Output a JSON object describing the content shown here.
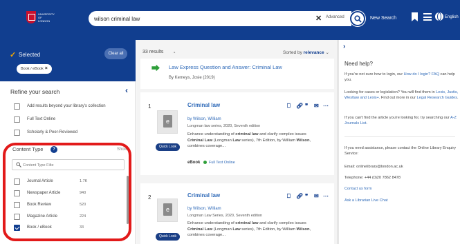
{
  "header": {
    "logo_text": "UNIVERSITY OF LONDON",
    "search_value": "wilson criminal law",
    "advanced_label": "Advanced",
    "new_search_label": "New Search",
    "language_label": "English",
    "accent_color": "#113e8f"
  },
  "sidebar": {
    "selected_label": "Selected",
    "clear_all_label": "Clear all",
    "selected_facet": "Book / eBook",
    "refine_title": "Refine your search",
    "refine_options": [
      {
        "label": "Add results beyond your library's collection",
        "checked": false
      },
      {
        "label": "Full Text Online",
        "checked": false
      },
      {
        "label": "Scholarly & Peer-Reviewed",
        "checked": false
      }
    ],
    "content_type_title": "Content Type",
    "content_type_badge": "?",
    "show_label": "Show",
    "filter_placeholder": "Content Type Filte",
    "content_types": [
      {
        "label": "Journal Article",
        "count": "1.7K",
        "checked": false
      },
      {
        "label": "Newspaper Article",
        "count": "940",
        "checked": false
      },
      {
        "label": "Book Review",
        "count": "520",
        "checked": false
      },
      {
        "label": "Magazine Article",
        "count": "224",
        "checked": false
      },
      {
        "label": "Book / eBook",
        "count": "33",
        "checked": true
      }
    ],
    "highlight_color": "#e21a1a"
  },
  "results": {
    "count_label": "33 results",
    "sorted_prefix": "Sorted by",
    "sorted_value": "relevance",
    "express": {
      "title": "Law Express Question and Answer: Criminal Law",
      "author": "By Kemeys, Josie (2019)"
    },
    "items": [
      {
        "number": "1",
        "title": "Criminal law",
        "author": "by Wilson, William",
        "series": "Longman law series, 2020, Seventh edition",
        "abstract_parts": [
          "Enhance understanding of ",
          "criminal law",
          " and clarify complex issues ",
          "Criminal Law",
          " (Longman ",
          "Law",
          " series), 7th Edition, by William ",
          "Wilson",
          ", combines coverage..."
        ],
        "format": "eBook",
        "availability": "Full Text Online",
        "quick_look": "Quick Look"
      },
      {
        "number": "2",
        "title": "Criminal law",
        "author": "by Wilson, William",
        "series": "Longman Law Series, 2020, Seventh edition",
        "abstract_parts": [
          "Enhance understanding of ",
          "criminal law",
          " and clarify complex issues ",
          "Criminal Law",
          " (Longman ",
          "Law",
          " series), 7th Edition, by William ",
          "Wilson",
          ", combines coverage..."
        ],
        "quick_look": "Quick Look"
      }
    ],
    "actions": [
      "bookmark-icon",
      "link-icon",
      "quote-icon",
      "email-icon",
      "more-icon"
    ]
  },
  "help": {
    "title": "Need help?",
    "p1_a": "If you're not sure how to login, our ",
    "p1_link": "How do I login? FAQ",
    "p1_b": " can help you.",
    "p2_a": "Looking for cases or legislation? You will find them in ",
    "p2_link": "Lexis, Justis, Westlaw and Lexis+",
    "p2_b": ". Find out more in our ",
    "p2_link2": "Legal Research Guides",
    "p2_c": ".",
    "p3_a": "If you can't find the article you're looking for, try searching our ",
    "p3_link": "A-Z Journals List",
    "p3_b": ".",
    "p4": "If you need assistance, please contact the Online Library Enquiry Service:",
    "email": "Email: onlinelibrary@london.ac.uk",
    "phone": "Telephone: +44 (0)20 7862 8478",
    "contact_link": "Contact us form",
    "chat_link": "Ask a Librarian Live Chat"
  }
}
